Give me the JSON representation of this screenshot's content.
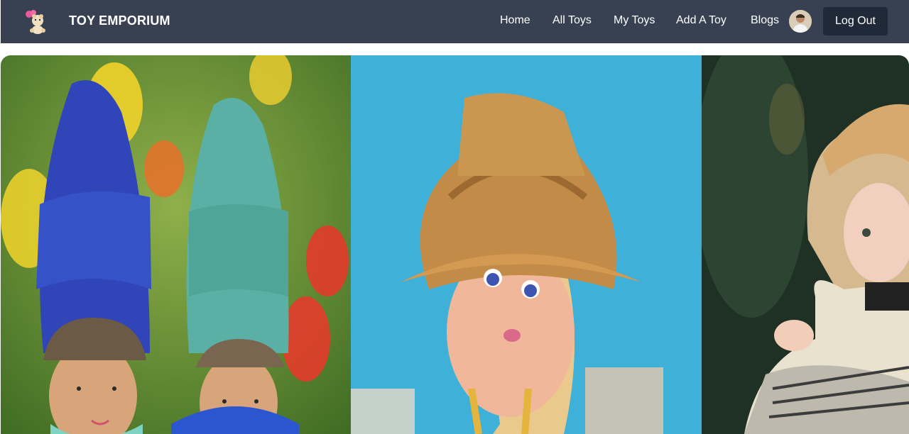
{
  "navbar": {
    "brand_name": "TOY EMPORIUM",
    "logo_icon": "toy-bear-logo-icon",
    "links": [
      {
        "label": "Home"
      },
      {
        "label": "All Toys"
      },
      {
        "label": "My Toys"
      },
      {
        "label": "Add A Toy"
      },
      {
        "label": "Blogs"
      }
    ],
    "logout_label": "Log Out",
    "background_color": "#374151",
    "button_color": "#1f2937"
  },
  "banner": {
    "slides": [
      {
        "image": "knitted-gnome-dolls-photo"
      },
      {
        "image": "straw-hat-doll-photo"
      },
      {
        "image": "porcelain-doll-photo"
      }
    ]
  }
}
